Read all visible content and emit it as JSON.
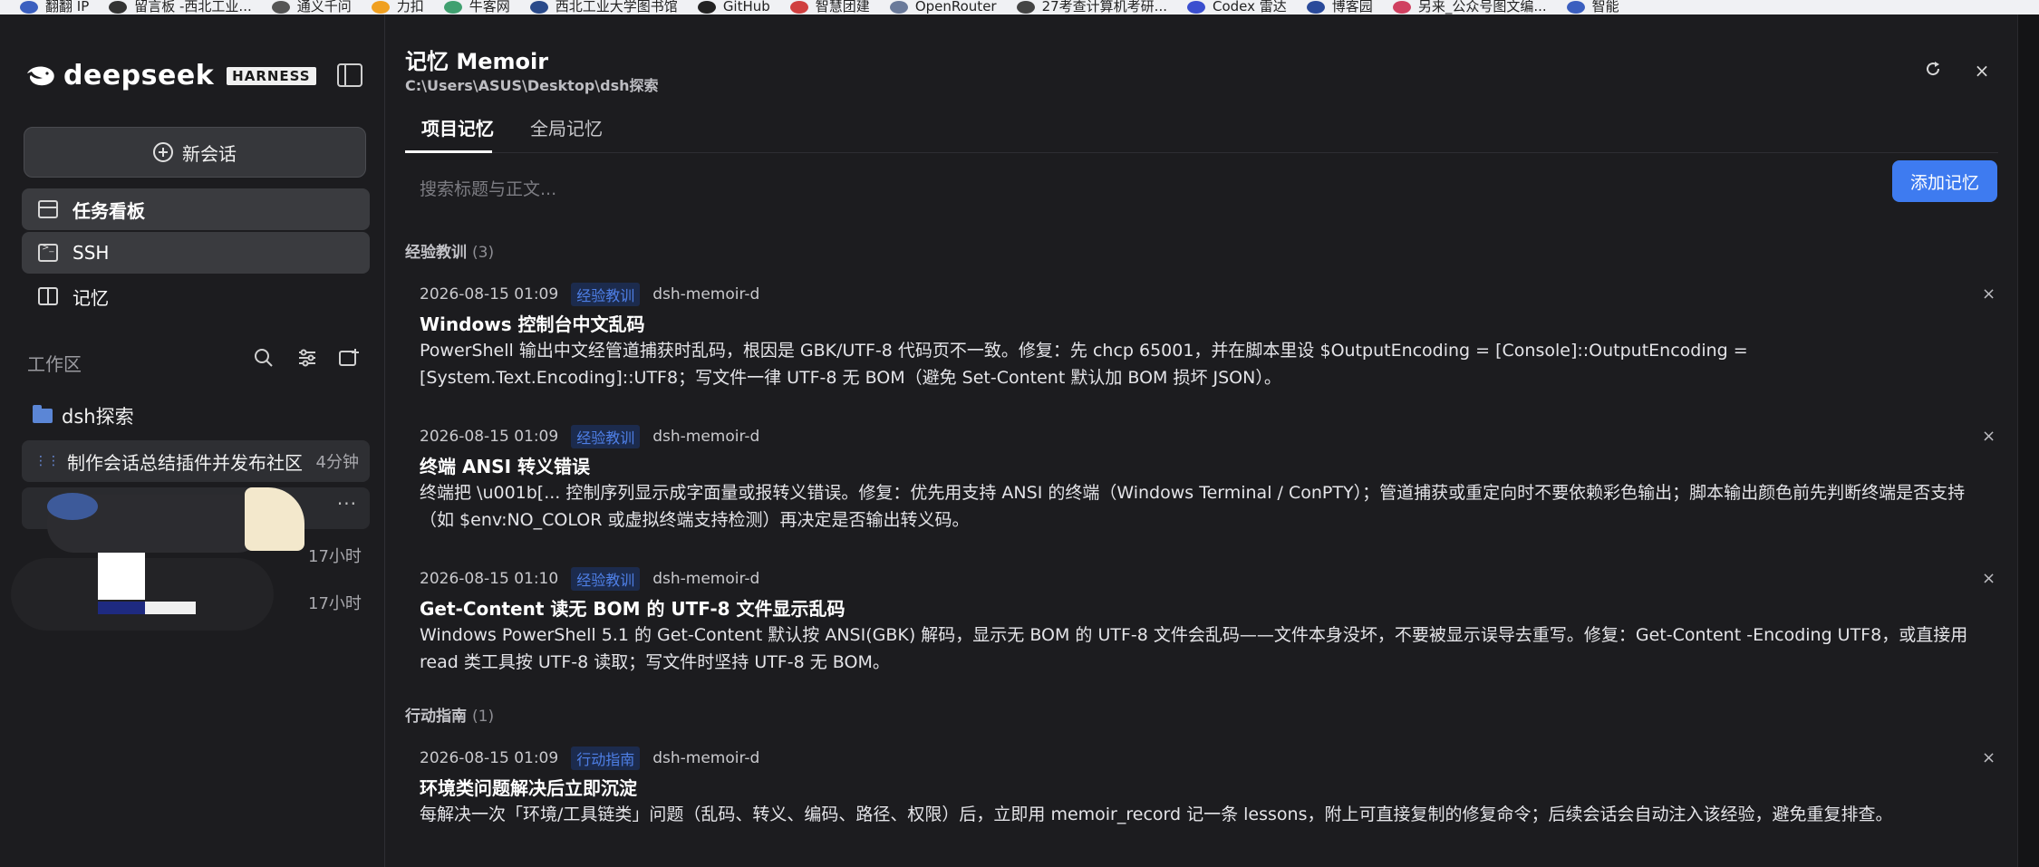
{
  "bookmarks": [
    {
      "label": "翻翻 IP",
      "color": "#3b5fbf"
    },
    {
      "label": "留言板 -西北工业...",
      "color": "#333333"
    },
    {
      "label": "通义千问",
      "color": "#555555"
    },
    {
      "label": "力扣",
      "color": "#f0a020"
    },
    {
      "label": "牛客网",
      "color": "#40a070"
    },
    {
      "label": "西北工业大学图书馆",
      "color": "#2a4a8a"
    },
    {
      "label": "GitHub",
      "color": "#222222"
    },
    {
      "label": "智慧团建",
      "color": "#d04040"
    },
    {
      "label": "OpenRouter",
      "color": "#6a7a9a"
    },
    {
      "label": "27考查计算机考研...",
      "color": "#444444"
    },
    {
      "label": "Codex 雷达",
      "color": "#3b4fcf"
    },
    {
      "label": "博客园",
      "color": "#2a4a9a"
    },
    {
      "label": "另来_公众号图文编...",
      "color": "#d04060"
    },
    {
      "label": "智能",
      "color": "#3b5fbf"
    }
  ],
  "sidebar": {
    "logo_text": "deepseek",
    "logo_badge": "HARNESS",
    "new_chat_label": "新会话",
    "nav": [
      {
        "label": "任务看板",
        "active": true
      },
      {
        "label": "SSH",
        "active": true
      },
      {
        "label": "记忆",
        "active": false
      }
    ],
    "workspace_label": "工作区",
    "folder_label": "dsh探索",
    "sessions": [
      {
        "title": "制作会话总结插件并发布社区",
        "time": "4分钟"
      }
    ],
    "older_times": [
      "17小时",
      "17小时"
    ],
    "more_glyph": "···"
  },
  "main": {
    "title": "记忆 Memoir",
    "path": "C:\\Users\\ASUS\\Desktop\\dsh探索",
    "tabs": [
      {
        "label": "项目记忆",
        "active": true
      },
      {
        "label": "全局记忆",
        "active": false
      }
    ],
    "search_placeholder": "搜索标题与正文...",
    "add_button": "添加记忆",
    "sections": [
      {
        "name": "经验教训",
        "count": "(3)",
        "entries": [
          {
            "date": "2026-08-15 01:09",
            "tag": "经验教训",
            "owner": "dsh-memoir-d",
            "title": "Windows 控制台中文乱码",
            "body": "PowerShell 输出中文经管道捕获时乱码，根因是 GBK/UTF-8 代码页不一致。修复：先 chcp 65001，并在脚本里设 $OutputEncoding = [Console]::OutputEncoding = [System.Text.Encoding]::UTF8；写文件一律 UTF-8 无 BOM（避免 Set-Content 默认加 BOM 损坏 JSON）。"
          },
          {
            "date": "2026-08-15 01:09",
            "tag": "经验教训",
            "owner": "dsh-memoir-d",
            "title": "终端 ANSI 转义错误",
            "body": "终端把 \\u001b[... 控制序列显示成字面量或报转义错误。修复：优先用支持 ANSI 的终端（Windows Terminal / ConPTY）；管道捕获或重定向时不要依赖彩色输出；脚本输出颜色前先判断终端是否支持（如 $env:NO_COLOR 或虚拟终端支持检测）再决定是否输出转义码。"
          },
          {
            "date": "2026-08-15 01:10",
            "tag": "经验教训",
            "owner": "dsh-memoir-d",
            "title": "Get-Content 读无 BOM 的 UTF-8 文件显示乱码",
            "body": "Windows PowerShell 5.1 的 Get-Content 默认按 ANSI(GBK) 解码，显示无 BOM 的 UTF-8 文件会乱码——文件本身没坏，不要被显示误导去重写。修复：Get-Content -Encoding UTF8，或直接用 read 类工具按 UTF-8 读取；写文件时坚持 UTF-8 无 BOM。"
          }
        ]
      },
      {
        "name": "行动指南",
        "count": "(1)",
        "entries": [
          {
            "date": "2026-08-15 01:09",
            "tag": "行动指南",
            "owner": "dsh-memoir-d",
            "title": "环境类问题解决后立即沉淀",
            "body": "每解决一次「环境/工具链类」问题（乱码、转义、编码、路径、权限）后，立即用 memoir_record 记一条 lessons，附上可直接复制的修复命令；后续会话会自动注入该经验，避免重复排查。"
          }
        ]
      }
    ]
  },
  "icons": {
    "refresh": "refresh-icon",
    "close": "close-icon",
    "delete": "delete-icon",
    "search": "search-icon",
    "filter": "filter-icon",
    "new_folder": "add-folder-icon"
  },
  "colors": {
    "accent": "#3e7bf0",
    "tag_text": "#4e7fe6",
    "tag_bg": "#1c2b4d",
    "background": "#1c1c1f"
  }
}
